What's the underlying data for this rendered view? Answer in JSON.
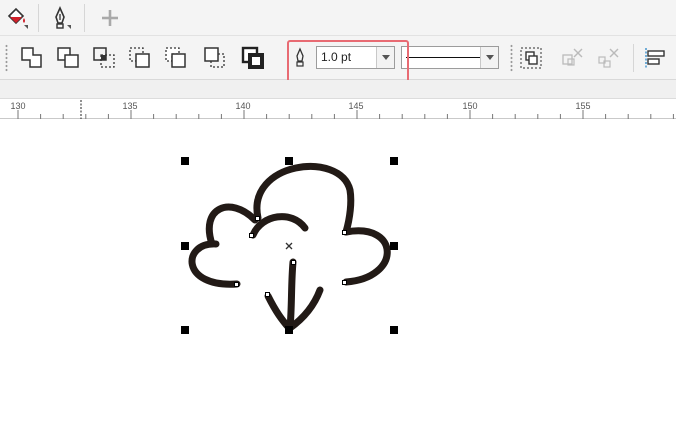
{
  "toolbar_top": {
    "fill_tool_icon": "fill-bucket-icon",
    "pen_tool_icon": "fountain-pen-icon",
    "add_icon": "plus-icon"
  },
  "shaping": {
    "buttons": [
      {
        "name": "weld-button",
        "icon": "weld-icon"
      },
      {
        "name": "trim-button",
        "icon": "trim-icon"
      },
      {
        "name": "intersect-button",
        "icon": "intersect-icon"
      },
      {
        "name": "simplify-button",
        "icon": "simplify-icon"
      },
      {
        "name": "front-minus-back-button",
        "icon": "front-minus-back-icon"
      },
      {
        "name": "back-minus-front-button",
        "icon": "back-minus-front-icon"
      },
      {
        "name": "create-boundary-button",
        "icon": "boundary-icon"
      }
    ]
  },
  "outline": {
    "pen_icon": "outline-pen-icon",
    "width_value": "1.0 pt",
    "style_preview": "solid-line"
  },
  "arrange": {
    "combine_icon": "combine-icon",
    "break_apart_icon": "break-apart-icon",
    "ungroup_icon": "ungroup-icon",
    "align_icon": "align-distribute-icon"
  },
  "ruler": {
    "labels": [
      "130",
      "135",
      "140",
      "145",
      "150",
      "155"
    ]
  },
  "colors": {
    "accent_highlight": "#e86b73",
    "stroke": "#221a16"
  }
}
